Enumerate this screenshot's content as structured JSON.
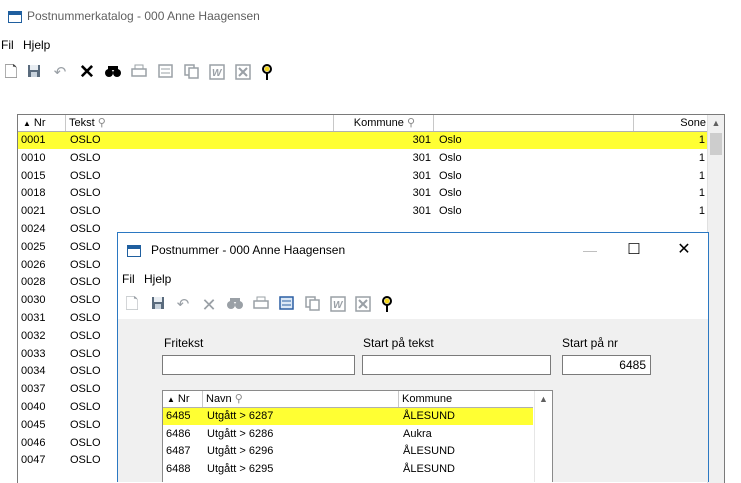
{
  "window": {
    "title": "Postnummerkatalog - 000 Anne Haagensen",
    "menu": [
      "Fil",
      "Hjelp"
    ]
  },
  "toolbar_icons": [
    "new-icon",
    "save-icon",
    "undo-icon",
    "delete-icon",
    "find-icon",
    "print-icon",
    "list-icon",
    "copy-icon",
    "word-icon",
    "excel-icon",
    "help-icon"
  ],
  "main_grid": {
    "headers": {
      "nr": "Nr",
      "tekst": "Tekst",
      "kommune": "Kommune",
      "kommune_name": "",
      "sone": "Sone"
    },
    "rows": [
      {
        "nr": "0001",
        "tekst": "OSLO",
        "kommune": "301",
        "navn": "Oslo",
        "sone": "1",
        "selected": true
      },
      {
        "nr": "0010",
        "tekst": "OSLO",
        "kommune": "301",
        "navn": "Oslo",
        "sone": "1"
      },
      {
        "nr": "0015",
        "tekst": "OSLO",
        "kommune": "301",
        "navn": "Oslo",
        "sone": "1"
      },
      {
        "nr": "0018",
        "tekst": "OSLO",
        "kommune": "301",
        "navn": "Oslo",
        "sone": "1"
      },
      {
        "nr": "0021",
        "tekst": "OSLO",
        "kommune": "301",
        "navn": "Oslo",
        "sone": "1"
      },
      {
        "nr": "0024",
        "tekst": "OSLO",
        "kommune": "",
        "navn": "",
        "sone": ""
      },
      {
        "nr": "0025",
        "tekst": "OSLO",
        "kommune": "",
        "navn": "",
        "sone": ""
      },
      {
        "nr": "0026",
        "tekst": "OSLO",
        "kommune": "",
        "navn": "",
        "sone": ""
      },
      {
        "nr": "0028",
        "tekst": "OSLO",
        "kommune": "",
        "navn": "",
        "sone": ""
      },
      {
        "nr": "0030",
        "tekst": "OSLO",
        "kommune": "",
        "navn": "",
        "sone": ""
      },
      {
        "nr": "0031",
        "tekst": "OSLO",
        "kommune": "",
        "navn": "",
        "sone": ""
      },
      {
        "nr": "0032",
        "tekst": "OSLO",
        "kommune": "",
        "navn": "",
        "sone": ""
      },
      {
        "nr": "0033",
        "tekst": "OSLO",
        "kommune": "",
        "navn": "",
        "sone": ""
      },
      {
        "nr": "0034",
        "tekst": "OSLO",
        "kommune": "",
        "navn": "",
        "sone": ""
      },
      {
        "nr": "0037",
        "tekst": "OSLO",
        "kommune": "",
        "navn": "",
        "sone": ""
      },
      {
        "nr": "0040",
        "tekst": "OSLO",
        "kommune": "",
        "navn": "",
        "sone": ""
      },
      {
        "nr": "0045",
        "tekst": "OSLO",
        "kommune": "",
        "navn": "",
        "sone": ""
      },
      {
        "nr": "0046",
        "tekst": "OSLO",
        "kommune": "",
        "navn": "",
        "sone": ""
      },
      {
        "nr": "0047",
        "tekst": "OSLO",
        "kommune": "",
        "navn": "",
        "sone": ""
      }
    ]
  },
  "dialog": {
    "title": "Postnummer - 000 Anne Haagensen",
    "menu": [
      "Fil",
      "Hjelp"
    ],
    "fields": {
      "fritekst_label": "Fritekst",
      "fritekst_value": "",
      "start_tekst_label": "Start på tekst",
      "start_tekst_value": "",
      "start_nr_label": "Start på nr",
      "start_nr_value": "6485"
    },
    "grid": {
      "headers": {
        "nr": "Nr",
        "navn": "Navn",
        "kommune": "Kommune"
      },
      "rows": [
        {
          "nr": "6485",
          "navn": "Utgått > 6287",
          "kommune": "ÅLESUND",
          "selected": true
        },
        {
          "nr": "6486",
          "navn": "Utgått > 6286",
          "kommune": "Aukra"
        },
        {
          "nr": "6487",
          "navn": "Utgått > 6296",
          "kommune": "ÅLESUND"
        },
        {
          "nr": "6488",
          "navn": "Utgått > 6295",
          "kommune": "ÅLESUND"
        }
      ]
    }
  },
  "colors": {
    "selected_row": "#ffff33",
    "dialog_border": "#2b78c2"
  }
}
